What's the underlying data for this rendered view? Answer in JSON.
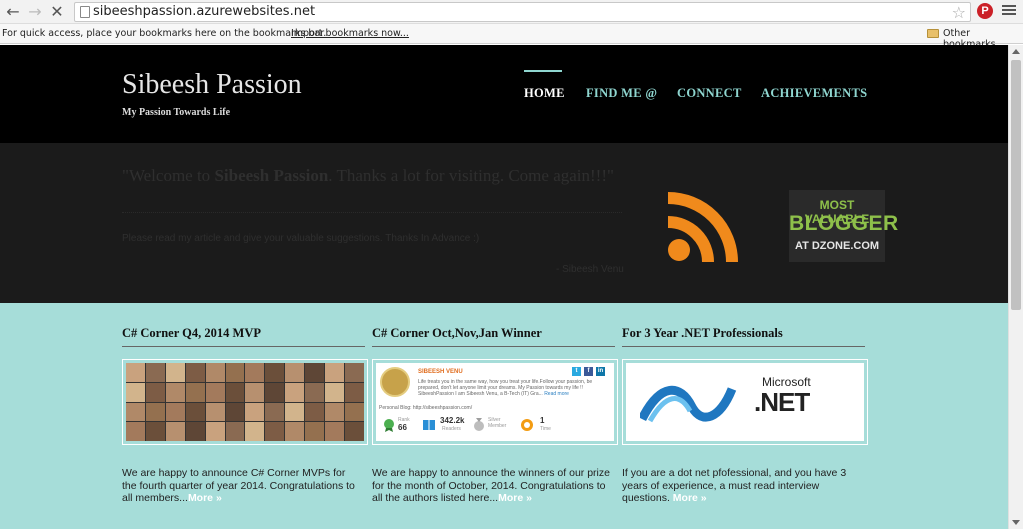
{
  "browser": {
    "back_icon": "arrow-left-icon",
    "forward_icon": "arrow-right-icon",
    "reload_icon": "close-icon",
    "url": "sibeeshpassion.azurewebsites.net",
    "bookmarks_prompt": "For quick access, place your bookmarks here on the bookmarks bar.",
    "import_bookmarks": "Import bookmarks now...",
    "other_bookmarks": "Other bookmarks"
  },
  "header": {
    "title": "Sibeesh Passion",
    "tagline": "My Passion Towards Life",
    "nav": [
      "HOME",
      "FIND ME @",
      "CONNECT",
      "ACHIEVEMENTS"
    ],
    "active_nav": "HOME"
  },
  "welcome": {
    "heading_pre": "\"Welcome to ",
    "heading_bold": "Sibeesh Passion",
    "heading_post": ". Thanks a lot for visiting. Come again!!!\"",
    "text": "Please read my article and give your valuable suggestions. Thanks In Advance :)",
    "signature": "- Sibeesh Venu"
  },
  "badge": {
    "line1": "MOST VALUABLE",
    "line2": "BLOGGER",
    "line3": "AT DZONE.COM"
  },
  "cards": [
    {
      "title": "C# Corner Q4, 2014 MVP",
      "text": "We are happy to announce C# Corner MVPs for the fourth quarter of year 2014. Congratulations to all members...",
      "more": "More »"
    },
    {
      "title": "C# Corner Oct,Nov,Jan Winner",
      "text": "We are happy to announce the winners of our prize for the month of October, 2014. Congratulations to all the authors listed here...",
      "more": "More »"
    },
    {
      "title": "For 3 Year .NET Professionals",
      "text": "If you are a dot net pfofessional, and you have 3 years of experience, a must read interview questions. ",
      "more": "More »"
    }
  ],
  "profile": {
    "name": "SIBEESH VENU",
    "bio": "Life treats you in the same way, how you treat your life.Follow your passion, be prepared, don't let anyone limit your dreams. My Passion towards my life !! SibeeshPassion I am Sibeesh Venu, a B-Tech (IT) Gra...",
    "bio_more": "Read more",
    "blog": "Personal Blog: http://sibeeshpassion.com/",
    "stats": [
      {
        "value": "66",
        "label": "Rank"
      },
      {
        "value": "342.2k",
        "label": "Readers"
      },
      {
        "value": "",
        "label": "Silver Member"
      },
      {
        "value": "1",
        "label": "Time"
      }
    ]
  },
  "dotnet": {
    "microsoft": "Microsoft",
    "net": ".NET"
  },
  "colors": {
    "nav_link": "#8fd6d0",
    "content_bg": "#a6ddd9",
    "rss": "#f08a1c",
    "badge_green": "#8ec04a"
  }
}
